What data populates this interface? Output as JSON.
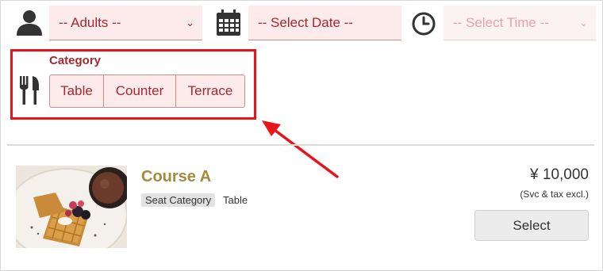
{
  "filters": {
    "adults": {
      "icon": "person-icon",
      "value": "-- Adults --"
    },
    "date": {
      "icon": "calendar-icon",
      "value": "-- Select Date --"
    },
    "time": {
      "icon": "clock-icon",
      "value": "-- Select Time --"
    }
  },
  "category": {
    "icon": "utensils-icon",
    "label": "Category",
    "options": [
      "Table",
      "Counter",
      "Terrace"
    ]
  },
  "course": {
    "title": "Course A",
    "seat_category_label": "Seat Category",
    "seat_category_value": "Table",
    "price": "¥ 10,000",
    "price_note": "(Svc & tax excl.)",
    "select_label": "Select",
    "image": "waffle-with-berries-photo"
  },
  "colors": {
    "accent": "#a3282f",
    "field_bg": "#fdeaea",
    "title_gold": "#a48b3b",
    "highlight_red": "#e8141b"
  }
}
